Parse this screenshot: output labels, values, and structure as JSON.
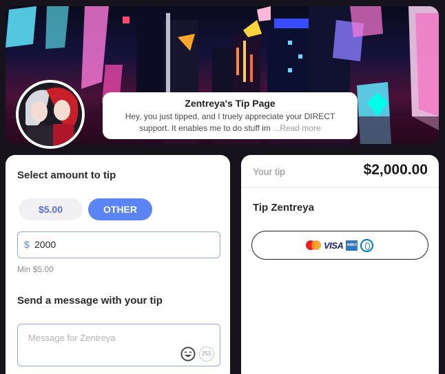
{
  "creator": {
    "page_title": "Zentreya's Tip Page",
    "bio_text": "Hey, you just tipped, and I truely appreciate your DIRECT support. It enables me to do stuff im",
    "read_more": "...Read more"
  },
  "tip_form": {
    "select_amount_title": "Select amount to tip",
    "preset_amount": "$5.00",
    "other_label": "OTHER",
    "currency_symbol": "$",
    "amount_value": "2000",
    "min_text": "Min $5.00",
    "message_title": "Send a message with your tip",
    "message_placeholder": "Message for Zentreya",
    "char_count": "255"
  },
  "summary": {
    "your_tip_label": "Your tip",
    "tip_total": "$2,000.00",
    "tip_to": "Tip Zentreya",
    "card_logos": {
      "visa": "VISA",
      "amex": "AMEX"
    }
  },
  "colors": {
    "accent": "#5b84f4",
    "page_bg": "#17131d"
  },
  "icons": [
    "mastercard-icon",
    "visa-icon",
    "amex-icon",
    "diners-icon",
    "smiley-emoji-icon"
  ]
}
